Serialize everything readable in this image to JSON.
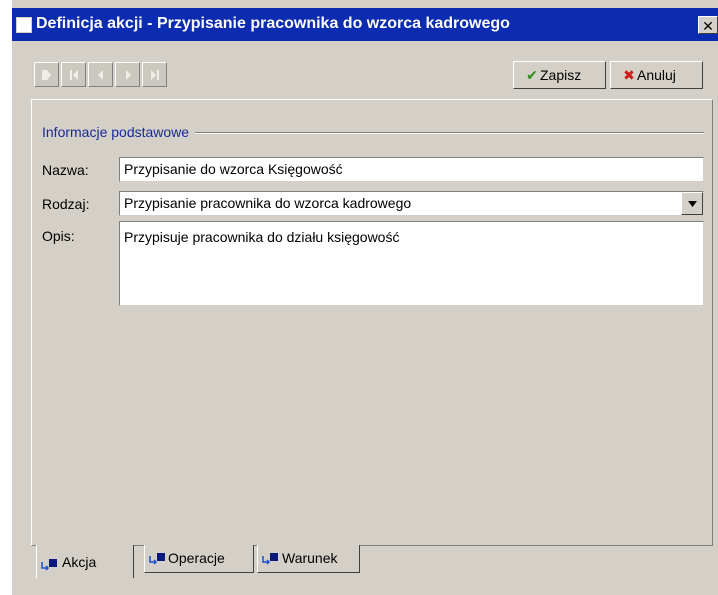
{
  "window": {
    "title": "Definicja akcji - Przypisanie pracownika do wzorca kadrowego",
    "close_label": "✕",
    "title_bar_color": "#0b2bb0"
  },
  "toolbar": {
    "nav_buttons": [
      {
        "name": "record-icon",
        "enabled": false
      },
      {
        "name": "first-icon",
        "enabled": false
      },
      {
        "name": "previous-icon",
        "enabled": false
      },
      {
        "name": "next-icon",
        "enabled": false
      },
      {
        "name": "last-icon",
        "enabled": false
      }
    ],
    "save": {
      "label": "Zapisz",
      "icon": "checkmark-icon",
      "icon_color": "#2e8b1a"
    },
    "cancel": {
      "label": "Anuluj",
      "icon": "cross-icon",
      "icon_color": "#d01818"
    }
  },
  "form": {
    "group_title": "Informacje podstawowe",
    "name": {
      "label": "Nazwa:",
      "value": "Przypisanie do wzorca Księgowość"
    },
    "type": {
      "label": "Rodzaj:",
      "value": "Przypisanie pracownika do wzorca kadrowego"
    },
    "description": {
      "label": "Opis:",
      "value": "Przypisuje pracownika do działu księgowość"
    }
  },
  "tabs": [
    {
      "label": "Akcja",
      "active": true
    },
    {
      "label": "Operacje",
      "active": false
    },
    {
      "label": "Warunek",
      "active": false
    }
  ]
}
